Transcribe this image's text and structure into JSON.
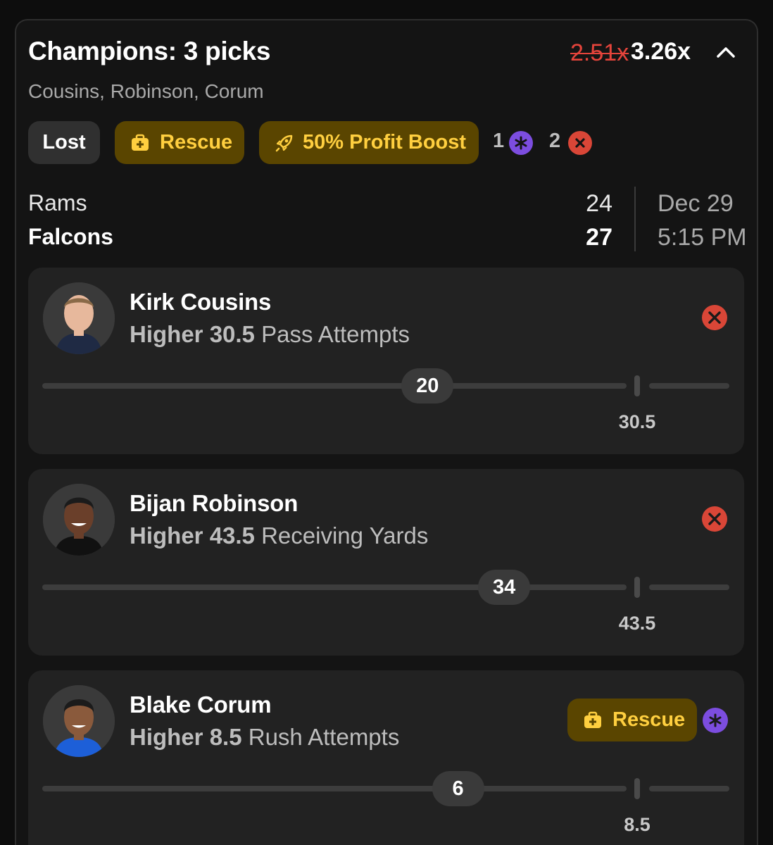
{
  "entry": {
    "title": "Champions: 3 picks",
    "old_multiplier": "2.51x",
    "new_multiplier": "3.26x",
    "players_summary": "Cousins, Robinson, Corum",
    "status_label": "Lost",
    "rescue_label": "Rescue",
    "boost_label": "50% Profit Boost",
    "rescued_count": "1",
    "lost_count": "2"
  },
  "game": {
    "team1": "Rams",
    "score1": "24",
    "team2": "Falcons",
    "score2": "27",
    "date": "Dec 29",
    "time": "5:15 PM"
  },
  "picks": [
    {
      "name": "Kirk Cousins",
      "direction": "Higher",
      "line": "30.5",
      "stat": "Pass Attempts",
      "actual": "20",
      "actual_value": 20,
      "target": "30.5",
      "status": "lost"
    },
    {
      "name": "Bijan Robinson",
      "direction": "Higher",
      "line": "43.5",
      "stat": "Receiving Yards",
      "actual": "34",
      "actual_value": 34,
      "target": "43.5",
      "status": "lost"
    },
    {
      "name": "Blake Corum",
      "direction": "Higher",
      "line": "8.5",
      "stat": "Rush Attempts",
      "actual": "6",
      "actual_value": 6,
      "target": "8.5",
      "status": "rescued",
      "rescue_label": "Rescue"
    }
  ],
  "colors": {
    "accent_gold": "#ffcf3f",
    "pill_gold_bg": "#5a4500",
    "loss_red": "#d94637",
    "rescue_purple": "#7c4ddf"
  },
  "icons": {
    "collapse": "chevron-up-icon",
    "rescue": "medkit-icon",
    "boost": "rocket-icon",
    "rescued": "asterisk-icon",
    "lost": "x-circle-icon"
  }
}
